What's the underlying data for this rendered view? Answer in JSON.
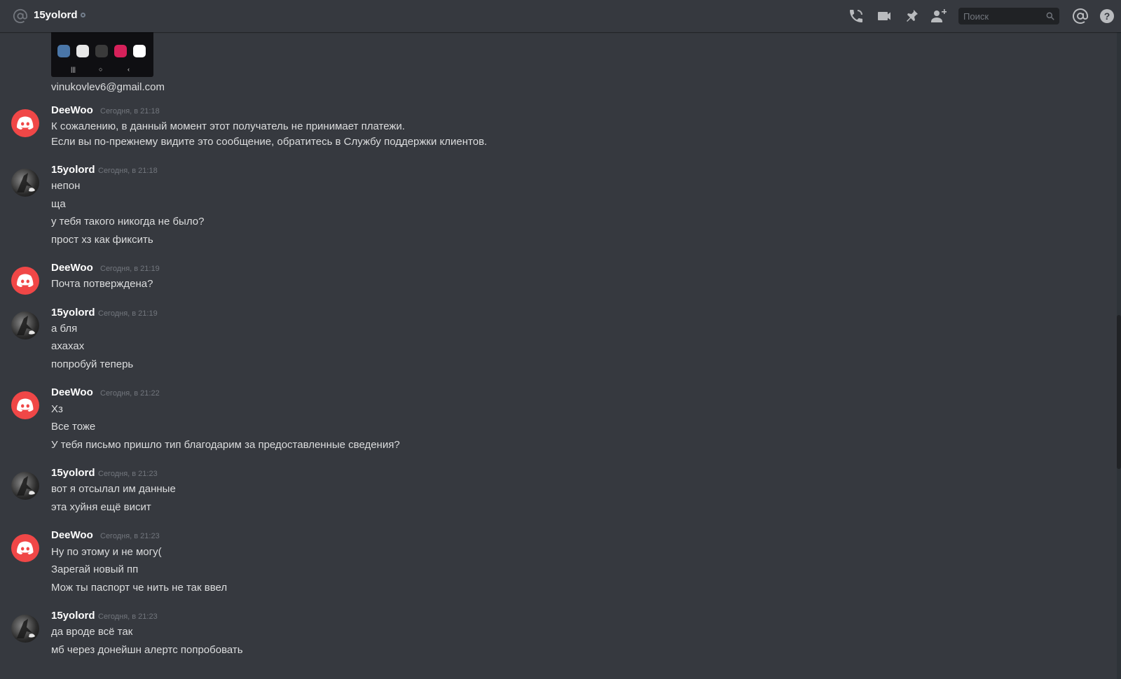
{
  "header": {
    "title": "15yolord",
    "search_placeholder": "Поиск"
  },
  "attachment_email": "vinukovlev6@gmail.com",
  "messages": [
    {
      "author": "DeeWoo",
      "time": "Сегодня, в 21:18",
      "lines": [
        "К сожалению, в данный момент этот получатель не принимает платежи.",
        "Если вы по-прежнему видите это сообщение, обратитесь в Службу поддержки клиентов."
      ]
    },
    {
      "author": "15yolord",
      "time": "Сегодня, в 21:18",
      "lines": [
        "непон",
        "ща",
        "у тебя такого никогда не было?",
        "прост хз как фиксить"
      ]
    },
    {
      "author": "DeeWoo",
      "time": "Сегодня, в 21:19",
      "lines": [
        "Почта потверждена?"
      ]
    },
    {
      "author": "15yolord",
      "time": "Сегодня, в 21:19",
      "lines": [
        "а бля",
        "ахахах",
        "попробуй теперь"
      ]
    },
    {
      "author": "DeeWoo",
      "time": "Сегодня, в 21:22",
      "lines": [
        "Хз",
        "Все тоже",
        "У тебя письмо пришло тип благодарим за предоставленные сведения?"
      ]
    },
    {
      "author": "15yolord",
      "time": "Сегодня, в 21:23",
      "lines": [
        "вот я отсылал им данные",
        "эта хуйня ещё висит"
      ]
    },
    {
      "author": "DeeWoo",
      "time": "Сегодня, в 21:23",
      "lines": [
        "Ну по этому и не могу(",
        "Зарегай новый пп",
        "Мож ты паспорт че нить не так ввел"
      ]
    },
    {
      "author": "15yolord",
      "time": "Сегодня, в 21:23",
      "lines": [
        "да вроде всё так",
        "мб через донейшн алертс попробовать"
      ]
    }
  ]
}
